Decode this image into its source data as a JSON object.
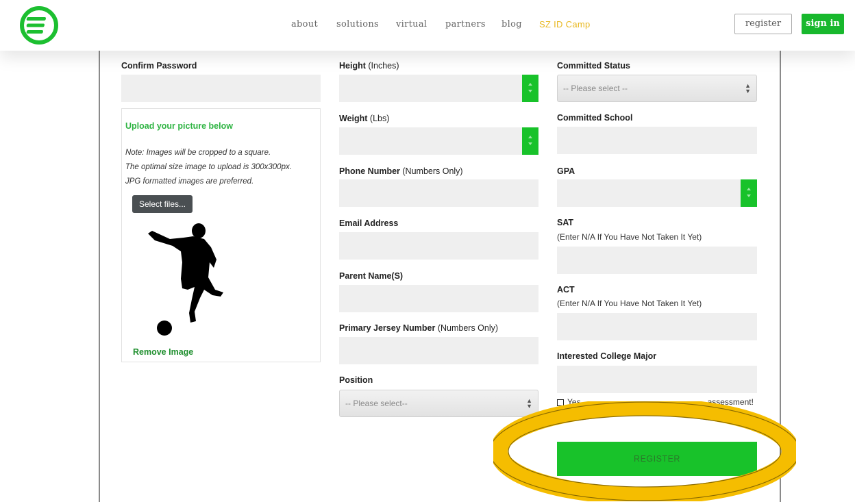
{
  "header": {
    "nav": [
      "about",
      "solutions",
      "virtual",
      "partners",
      "blog",
      "SZ ID Camp"
    ],
    "register_label": "register",
    "signin_label": "sign in"
  },
  "form": {
    "col1": {
      "confirm_password_label": "Confirm Password",
      "upload_title": "Upload your picture below",
      "notes": [
        "Note: Images will be cropped to a square.",
        "The optimal size image to upload is 300x300px.",
        "JPG formatted images are preferred."
      ],
      "select_files_label": "Select files...",
      "remove_image_label": "Remove Image"
    },
    "col2": {
      "height_label": "Height",
      "height_unit": "(Inches)",
      "weight_label": "Weight",
      "weight_unit": "(Lbs)",
      "phone_label": "Phone Number",
      "phone_note": "(Numbers Only)",
      "email_label": "Email Address",
      "parent_label": "Parent Name(S)",
      "jersey_label": "Primary Jersey Number",
      "jersey_note": "(Numbers Only)",
      "position_label": "Position",
      "position_placeholder": "-- Please select--"
    },
    "col3": {
      "committed_status_label": "Committed Status",
      "committed_status_placeholder": "-- Please select --",
      "committed_school_label": "Committed School",
      "gpa_label": "GPA",
      "sat_label": "SAT",
      "sat_note": "(Enter N/A If You Have Not Taken It Yet)",
      "act_label": "ACT",
      "act_note": "(Enter N/A If You Have Not Taken It Yet)",
      "major_label": "Interested College Major",
      "checkbox_prefix": "Yes",
      "checkbox_suffix": "assessment!",
      "register_button": "REGISTER"
    }
  },
  "colors": {
    "brand_green": "#18c22a",
    "camp_link": "#e8b81f",
    "highlight": "#f5bd00"
  }
}
